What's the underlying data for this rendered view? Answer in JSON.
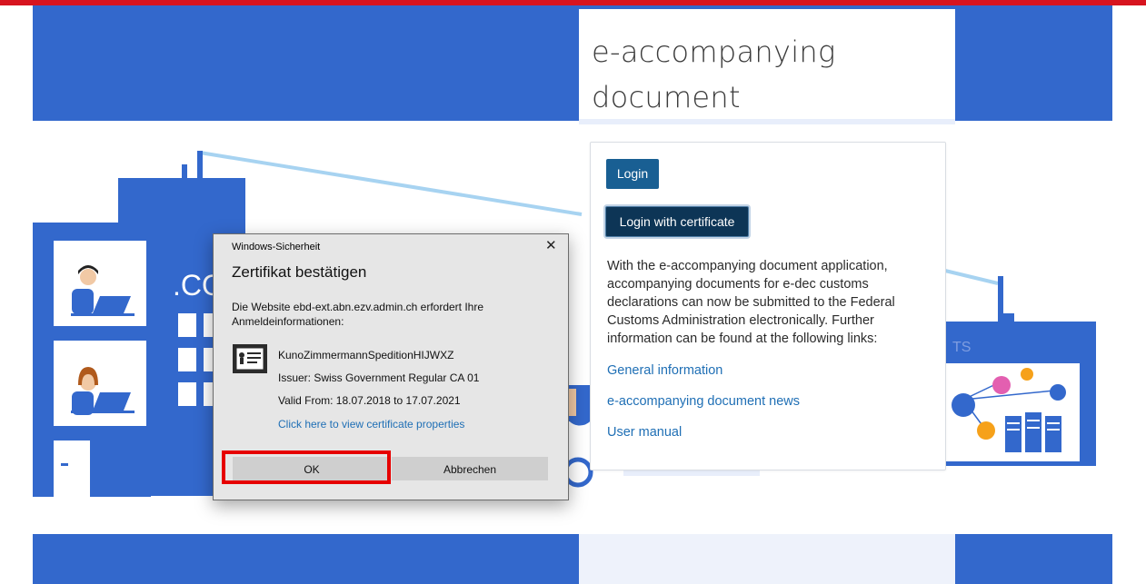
{
  "header": {
    "title_line1": "e-accompanying",
    "title_line2": "document"
  },
  "panel": {
    "login_label": "Login",
    "login_cert_label": "Login with certificate",
    "description": "With the e-accompanying document application, accompanying documents for e-dec customs declarations can now be submitted to the Federal Customs Administration electronically. Further information can be found at the following links:",
    "links": [
      {
        "label": "General information"
      },
      {
        "label": "e-accompanying document news"
      },
      {
        "label": "User manual"
      }
    ]
  },
  "illustration": {
    "building_text": ".CO",
    "right_panel_text": "TS"
  },
  "dialog": {
    "caption": "Windows-Sicherheit",
    "close_symbol": "✕",
    "title": "Zertifikat bestätigen",
    "message": "Die Website ebd-ext.abn.ezv.admin.ch erfordert Ihre Anmeldeinformationen:",
    "certificate": {
      "name": "KunoZimmermannSpeditionHIJWXZ",
      "issuer": "Issuer: Swiss Government Regular CA 01",
      "valid": "Valid From: 18.07.2018 to 17.07.2021",
      "properties_link": "Click here to view certificate properties"
    },
    "ok_label": "OK",
    "cancel_label": "Abbrechen"
  },
  "colors": {
    "brand_blue": "#3368cc",
    "top_red": "#d7141f",
    "login_btn": "#195f93",
    "login_cert_btn": "#0d3556",
    "link": "#1f6fb5",
    "highlight": "#e60000"
  }
}
